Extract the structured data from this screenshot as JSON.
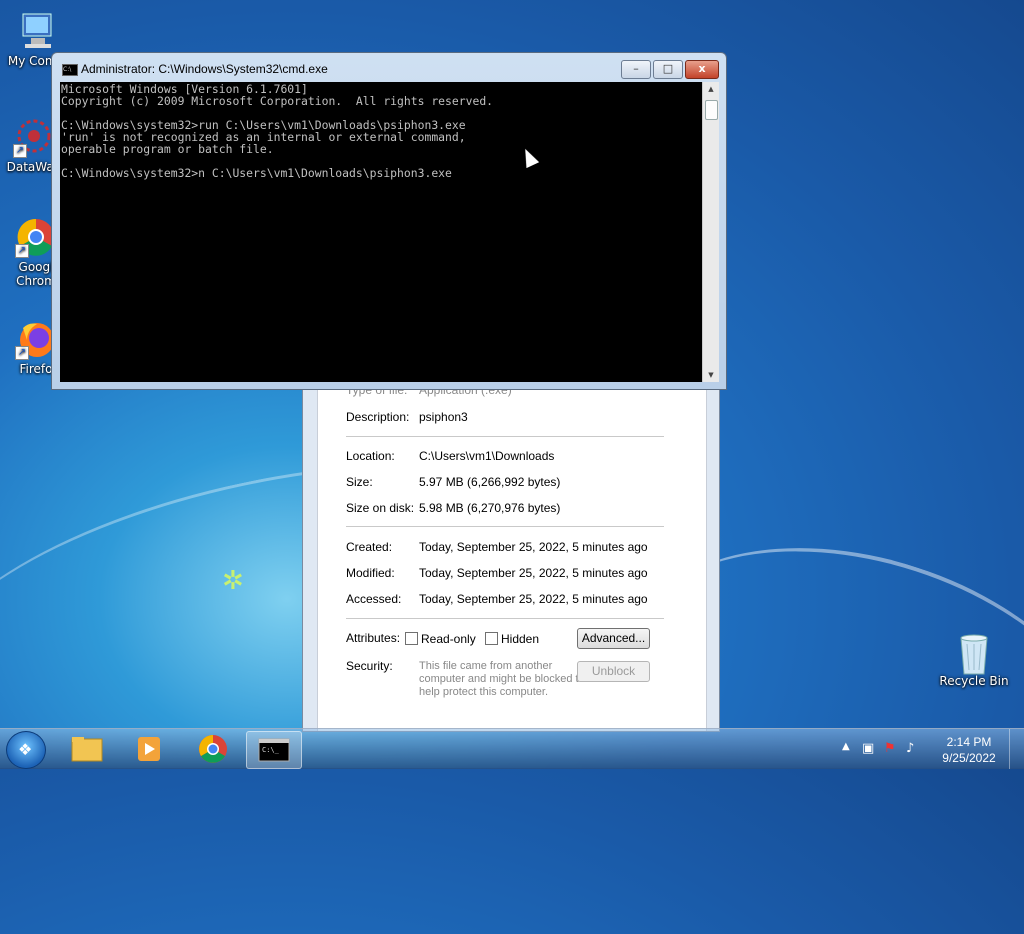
{
  "desktop": {
    "icons": [
      {
        "label": "My Comp"
      },
      {
        "label": "DataWag"
      },
      {
        "label": "Googl Chrom"
      },
      {
        "label": "Firefo"
      },
      {
        "label": "Recycle Bin"
      }
    ]
  },
  "cmd_window": {
    "title": "Administrator: C:\\Windows\\System32\\cmd.exe",
    "buttons": {
      "minimize": "–",
      "maximize": "□",
      "close": "x"
    },
    "console_lines": [
      "Microsoft Windows [Version 6.1.7601]",
      "Copyright (c) 2009 Microsoft Corporation.  All rights reserved.",
      "",
      "C:\\Windows\\system32>run C:\\Users\\vm1\\Downloads\\psiphon3.exe",
      "'run' is not recognized as an internal or external command,",
      "operable program or batch file.",
      "",
      "C:\\Windows\\system32>n C:\\Users\\vm1\\Downloads\\psiphon3.exe"
    ]
  },
  "properties_dialog": {
    "type_label": "Type of file:",
    "type_value": "Application (.exe)",
    "description_label": "Description:",
    "description_value": "psiphon3",
    "location_label": "Location:",
    "location_value": "C:\\Users\\vm1\\Downloads",
    "size_label": "Size:",
    "size_value": "5.97 MB (6,266,992 bytes)",
    "size_on_disk_label": "Size on disk:",
    "size_on_disk_value": "5.98 MB (6,270,976 bytes)",
    "created_label": "Created:",
    "created_value": "Today, September 25, 2022, 5 minutes ago",
    "modified_label": "Modified:",
    "modified_value": "Today, September 25, 2022, 5 minutes ago",
    "accessed_label": "Accessed:",
    "accessed_value": "Today, September 25, 2022, 5 minutes ago",
    "attributes_label": "Attributes:",
    "readonly_label": "Read-only",
    "hidden_label": "Hidden",
    "advanced_button": "Advanced...",
    "security_label": "Security:",
    "security_text": "This file came from another computer and might be blocked to help protect this computer.",
    "unblock_button": "Unblock"
  },
  "taskbar": {
    "time": "2:14 PM",
    "date": "9/25/2022",
    "items": [
      "start-button",
      "explorer",
      "media-player",
      "chrome",
      "cmd"
    ]
  }
}
